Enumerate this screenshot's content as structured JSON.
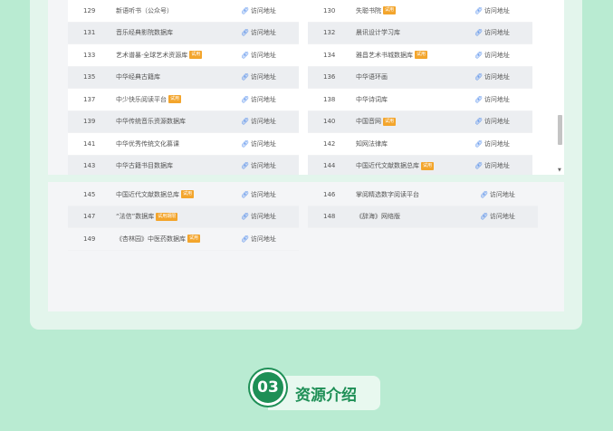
{
  "link_label": "访问地址",
  "scroll_rows": [
    {
      "left": {
        "num": "129",
        "name": "新语听书（公众号）",
        "tag": ""
      },
      "right": {
        "num": "130",
        "name": "失聪书院",
        "tag": "试用"
      }
    },
    {
      "left": {
        "num": "131",
        "name": "音乐经典影院数据库",
        "tag": ""
      },
      "right": {
        "num": "132",
        "name": "晨讯设计学习库",
        "tag": ""
      }
    },
    {
      "left": {
        "num": "133",
        "name": "艺术谱暴·全球艺术资源库",
        "tag": "试用"
      },
      "right": {
        "num": "134",
        "name": "雅昌艺术书城数据库",
        "tag": "试用"
      }
    },
    {
      "left": {
        "num": "135",
        "name": "中华经典古籍库",
        "tag": ""
      },
      "right": {
        "num": "136",
        "name": "中华语环画",
        "tag": ""
      }
    },
    {
      "left": {
        "num": "137",
        "name": "中少快乐阅读平台",
        "tag": "试用"
      },
      "right": {
        "num": "138",
        "name": "中华诗词库",
        "tag": ""
      }
    },
    {
      "left": {
        "num": "139",
        "name": "中华传统音乐资源数据库",
        "tag": ""
      },
      "right": {
        "num": "140",
        "name": "中国音网",
        "tag": "试用"
      }
    },
    {
      "left": {
        "num": "141",
        "name": "中华优秀传统文化慕课",
        "tag": ""
      },
      "right": {
        "num": "142",
        "name": "知网法律库",
        "tag": ""
      }
    },
    {
      "left": {
        "num": "143",
        "name": "中华古籍书目数据库",
        "tag": ""
      },
      "right": {
        "num": "144",
        "name": "中国近代文献数据总库",
        "tag": "试用"
      }
    }
  ],
  "lower_rows": [
    {
      "left": {
        "num": "145",
        "name": "中国近代文献数据总库",
        "tag": "试用"
      },
      "right": {
        "num": "146",
        "name": "掌阅精选数字阅读平台",
        "tag": ""
      }
    },
    {
      "left": {
        "num": "147",
        "name": "“法信”数据库",
        "tag": "试用期限"
      },
      "right": {
        "num": "148",
        "name": "《辞海》网络版",
        "tag": ""
      }
    },
    {
      "left": {
        "num": "149",
        "name": "《杏林园》中医药数据库",
        "tag": "试用"
      },
      "right": null
    }
  ],
  "section": {
    "number": "03",
    "title": "资源介绍"
  },
  "colors": {
    "background": "#b9ebd2",
    "accent_green": "#1e8f56",
    "tag_orange": "#f3a52c",
    "link_blue": "#3b7de9"
  },
  "icons": {
    "link": "link-icon",
    "scroll_down": "chevron-down-icon"
  }
}
